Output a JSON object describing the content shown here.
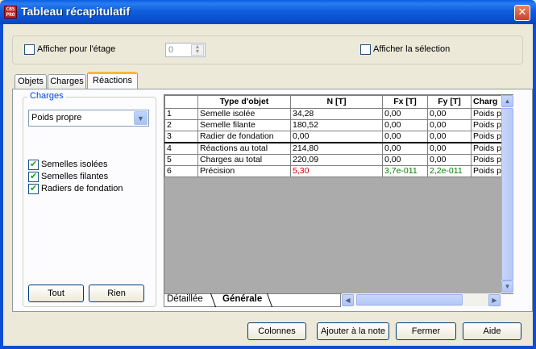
{
  "window": {
    "title": "Tableau récapitulatif",
    "app_icon_text": "CBS PRO",
    "close": "✕"
  },
  "top": {
    "floor_label": "Afficher pour l'étage",
    "floor_checked": false,
    "floor_value": "0",
    "selection_label": "Afficher la sélection",
    "selection_checked": false
  },
  "tabs": [
    {
      "label": "Objets",
      "selected": false
    },
    {
      "label": "Charges",
      "selected": false
    },
    {
      "label": "Réactions",
      "selected": true
    }
  ],
  "charges": {
    "legend": "Charges",
    "combo_value": "Poids propre",
    "checks": [
      {
        "label": "Semelles isolées",
        "checked": true
      },
      {
        "label": "Semelles filantes",
        "checked": true
      },
      {
        "label": "Radiers de fondation",
        "checked": true
      }
    ],
    "btn_all": "Tout",
    "btn_none": "Rien"
  },
  "grid": {
    "headers": [
      "Type d'objet",
      "N [T]",
      "Fx [T]",
      "Fy [T]",
      "Charg"
    ],
    "rows": [
      {
        "n": "1",
        "type": "Semelle isolée",
        "N": "34,28",
        "Fx": "0,00",
        "Fy": "0,00",
        "ch": "Poids p"
      },
      {
        "n": "2",
        "type": "Semelle filante",
        "N": "180,52",
        "Fx": "0,00",
        "Fy": "0,00",
        "ch": "Poids p"
      },
      {
        "n": "3",
        "type": "Radier de fondation",
        "N": "0,00",
        "Fx": "0,00",
        "Fy": "0,00",
        "ch": "Poids p"
      },
      {
        "n": "4",
        "type": "Réactions au total",
        "N": "214,80",
        "Fx": "0,00",
        "Fy": "0,00",
        "ch": "Poids p"
      },
      {
        "n": "5",
        "type": "Charges au total",
        "N": "220,09",
        "Fx": "0,00",
        "Fy": "0,00",
        "ch": "Poids p"
      },
      {
        "n": "6",
        "type": "Précision",
        "N": "5,30",
        "Fx": "3,7e-011",
        "Fy": "2,2e-011",
        "ch": "Poids p"
      }
    ],
    "sheet_tabs": [
      "Détaillée",
      "Générale"
    ],
    "colors": {
      "precision_n": "#d40000",
      "precision_f": "#008000"
    }
  },
  "buttons": {
    "columns": "Colonnes",
    "add_note": "Ajouter à la note",
    "close": "Fermer",
    "help": "Aide"
  }
}
